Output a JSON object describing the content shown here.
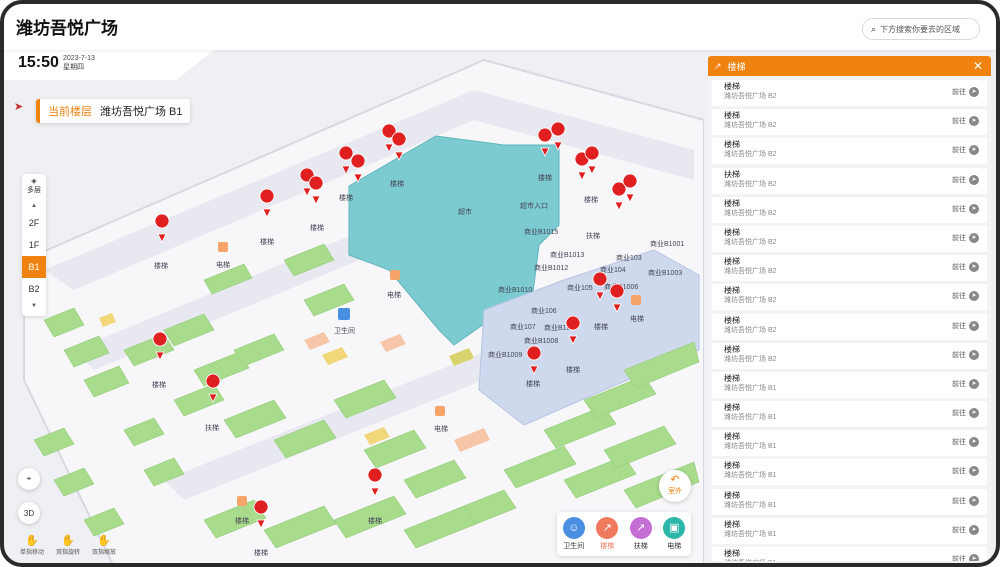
{
  "header": {
    "title": "潍坊吾悦广场",
    "search_placeholder": "下方搜索你要去的区域"
  },
  "clock": {
    "time": "15:50",
    "date": "2023-7-13",
    "weekday": "星期四"
  },
  "floor_badge": {
    "current_label": "当前楼层",
    "location": "潍坊吾悦广场  B1"
  },
  "floor_selector": {
    "layers_label": "多层",
    "floors": [
      "2F",
      "1F",
      "B1",
      "B2"
    ],
    "active": "B1"
  },
  "controls": {
    "view_3d": "3D",
    "outdoor": "室外"
  },
  "gestures": [
    "单指移动",
    "双指旋转",
    "双指缩放"
  ],
  "legend": [
    {
      "label": "卫生间",
      "color": "#4a90e2"
    },
    {
      "label": "楼梯",
      "color": "#f07a5e"
    },
    {
      "label": "扶梯",
      "color": "#c56fd6"
    },
    {
      "label": "电梯",
      "color": "#2cb5a8"
    }
  ],
  "map": {
    "store_labels": [
      "超市",
      "超市入口",
      "商业B1015",
      "商业B1013",
      "商业B1012",
      "商业B1001",
      "商业103",
      "商业104",
      "商业B1003",
      "商业B1010",
      "商业105",
      "商业B1006",
      "商业106",
      "商业107",
      "商业B1007",
      "商业B1008",
      "商业B1009"
    ],
    "facility_labels": [
      "楼梯",
      "扶梯",
      "电梯",
      "卫生间"
    ]
  },
  "panel": {
    "title": "楼梯",
    "go_label": "前往",
    "items": [
      {
        "name": "楼梯",
        "location": "潍坊吾悦广场 B2"
      },
      {
        "name": "楼梯",
        "location": "潍坊吾悦广场 B2"
      },
      {
        "name": "楼梯",
        "location": "潍坊吾悦广场 B2"
      },
      {
        "name": "扶梯",
        "location": "潍坊吾悦广场 B2"
      },
      {
        "name": "楼梯",
        "location": "潍坊吾悦广场 B2"
      },
      {
        "name": "楼梯",
        "location": "潍坊吾悦广场 B2"
      },
      {
        "name": "楼梯",
        "location": "潍坊吾悦广场 B2"
      },
      {
        "name": "楼梯",
        "location": "潍坊吾悦广场 B2"
      },
      {
        "name": "楼梯",
        "location": "潍坊吾悦广场 B2"
      },
      {
        "name": "楼梯",
        "location": "潍坊吾悦广场 B2"
      },
      {
        "name": "楼梯",
        "location": "潍坊吾悦广场 B1"
      },
      {
        "name": "楼梯",
        "location": "潍坊吾悦广场 B1"
      },
      {
        "name": "楼梯",
        "location": "潍坊吾悦广场 B1"
      },
      {
        "name": "楼梯",
        "location": "潍坊吾悦广场 B1"
      },
      {
        "name": "楼梯",
        "location": "潍坊吾悦广场 B1"
      },
      {
        "name": "楼梯",
        "location": "潍坊吾悦广场 B1"
      },
      {
        "name": "楼梯",
        "location": "潍坊吾悦广场 B1"
      }
    ]
  }
}
